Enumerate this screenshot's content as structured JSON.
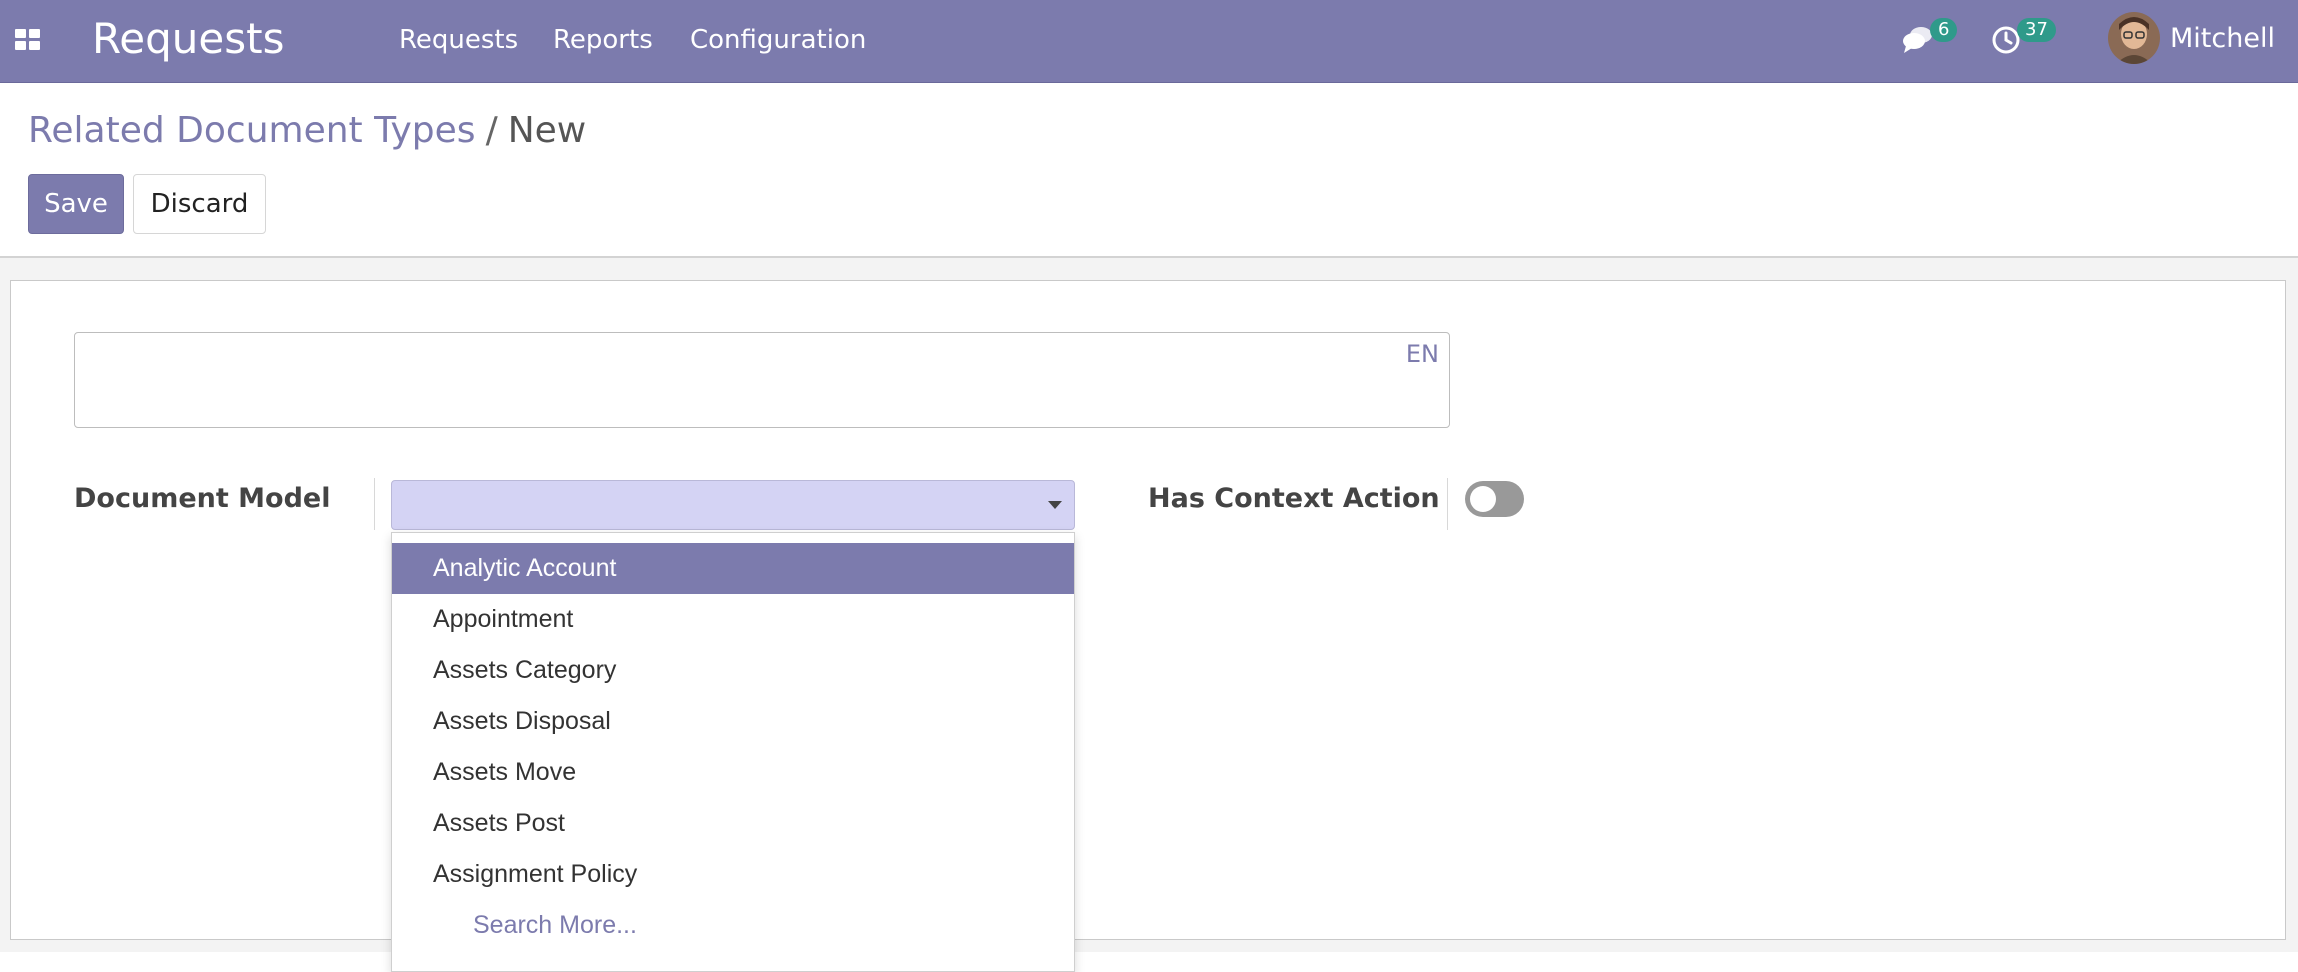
{
  "topbar": {
    "app_name": "Requests",
    "menu": [
      "Requests",
      "Reports",
      "Configuration"
    ],
    "messages_count": "6",
    "activities_count": "37",
    "user_name": "Mitchell"
  },
  "breadcrumb": {
    "parent": "Related Document Types",
    "separator": "/",
    "current": "New"
  },
  "buttons": {
    "save": "Save",
    "discard": "Discard"
  },
  "form": {
    "name_value": "",
    "lang_tag": "EN",
    "document_model_label": "Document Model",
    "document_model_value": "",
    "has_context_action_label": "Has Context Action",
    "has_context_action": false
  },
  "dropdown": {
    "items": [
      "Analytic Account",
      "Appointment",
      "Assets Category",
      "Assets Disposal",
      "Assets Move",
      "Assets Post",
      "Assignment Policy"
    ],
    "highlighted": "Analytic Account",
    "search_more": "Search More..."
  },
  "colors": {
    "brand": "#7c7bad",
    "badge": "#2f9a8a",
    "select_focus": "#d4d3f4",
    "toggle_off": "#999999"
  }
}
